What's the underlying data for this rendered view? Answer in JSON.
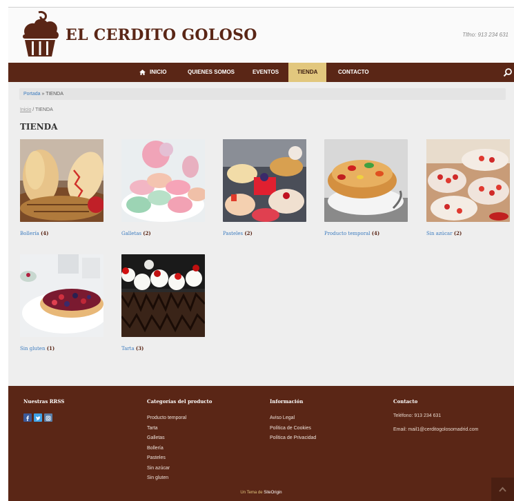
{
  "header": {
    "site_title": "EL CERDITO GOLOSO",
    "phone": "Tlfno: 913 234 631"
  },
  "nav": {
    "items": [
      {
        "label": "INICIO"
      },
      {
        "label": "QUIENES SOMOS"
      },
      {
        "label": "EVENTOS"
      },
      {
        "label": "TIENDA",
        "active": true
      },
      {
        "label": "CONTACTO"
      }
    ]
  },
  "breadcrumb_bar": {
    "link": "Portada",
    "separator": " » ",
    "current": "TIENDA"
  },
  "breadcrumb2": {
    "link": "Inicio",
    "separator": " / ",
    "current": "TIENDA"
  },
  "page_title": "TIENDA",
  "products": [
    {
      "name": "Bollería",
      "count": "(4)"
    },
    {
      "name": "Galletas",
      "count": "(2)"
    },
    {
      "name": "Pasteles",
      "count": "(2)"
    },
    {
      "name": "Producto temporal",
      "count": "(4)"
    },
    {
      "name": "Sin azúcar",
      "count": "(2)"
    },
    {
      "name": "Sin gluten",
      "count": "(1)"
    },
    {
      "name": "Tarta",
      "count": "(3)"
    }
  ],
  "footer": {
    "rrss_title": "Nuestras RRSS",
    "categories_title": "Categorías del producto",
    "categories": [
      "Producto temporal",
      "Tarta",
      "Galletas",
      "Bollería",
      "Pasteles",
      "Sin azúcar",
      "Sin gluten"
    ],
    "info_title": "Información",
    "info_links": [
      "Aviso Legal",
      "Política de Cookies",
      "Política de Privacidad"
    ],
    "contact_title": "Contacto",
    "contact_phone": "Teléfono: 913 234 631",
    "contact_email": "Email: mail1@cerditogolosomadrid.com",
    "credit_prefix": "Un Tema de ",
    "credit_link": "SiteOrigin"
  },
  "social_icons": [
    "facebook-icon",
    "twitter-icon",
    "instagram-icon"
  ],
  "colors": {
    "brand_brown": "#5a2616",
    "accent_gold": "#e2c77e",
    "link_blue": "#3b7bbf"
  }
}
